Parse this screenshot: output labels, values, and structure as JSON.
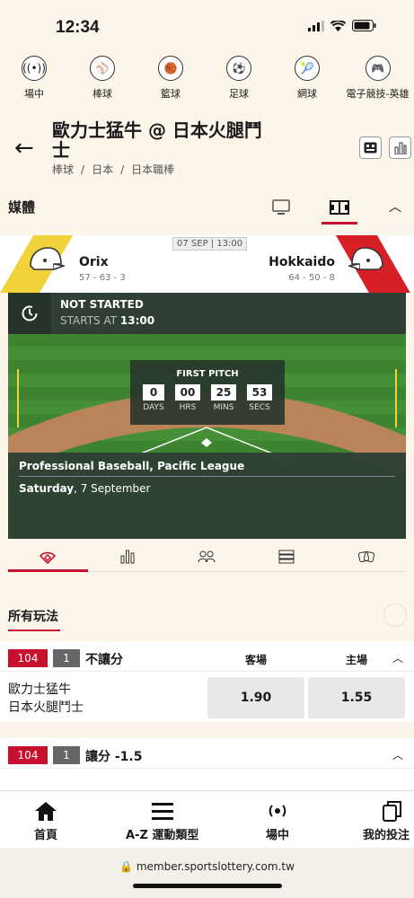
{
  "status_bar": {
    "time": "12:34"
  },
  "sports": [
    {
      "label": "場中",
      "icon": "live-icon"
    },
    {
      "label": "棒球",
      "icon": "baseball-icon"
    },
    {
      "label": "籃球",
      "icon": "basketball-icon"
    },
    {
      "label": "足球",
      "icon": "soccer-icon"
    },
    {
      "label": "網球",
      "icon": "tennis-icon"
    },
    {
      "label": "電子競技-英雄",
      "icon": "gamepad-icon"
    }
  ],
  "header": {
    "title": "歐力士猛牛 @ 日本火腿鬥士",
    "breadcrumb": [
      "棒球",
      "日本",
      "日本職棒"
    ]
  },
  "media": {
    "label": "媒體"
  },
  "match": {
    "date": "07 SEP | 13:00",
    "home": {
      "name": "Orix",
      "record": "57 - 63 - 3"
    },
    "away": {
      "name": "Hokkaido",
      "record": "64 - 50 - 8"
    },
    "status": "NOT STARTED",
    "starts_at_label": "STARTS AT",
    "starts_at_time": "13:00",
    "countdown_title": "FIRST PITCH",
    "countdown": [
      {
        "value": "0",
        "label": "DAYS"
      },
      {
        "value": "00",
        "label": "HRS"
      },
      {
        "value": "25",
        "label": "MINS"
      },
      {
        "value": "53",
        "label": "SECS"
      }
    ],
    "league": "Professional Baseball, Pacific League",
    "day": "Saturday",
    "day_date": ", 7 September"
  },
  "bets": {
    "section_title": "所有玩法",
    "markets": [
      {
        "code": "104",
        "num": "1",
        "type": "不讓分",
        "col1": "客場",
        "col2": "主場",
        "team1": "歐力士猛牛",
        "team2": "日本火腿鬥士",
        "odd1": "1.90",
        "odd2": "1.55"
      },
      {
        "code": "104",
        "num": "1",
        "type": "讓分 -1.5"
      }
    ]
  },
  "nav": {
    "home": "首頁",
    "az": "A-Z 運動類型",
    "live": "場中",
    "mybets": "我的投注"
  },
  "url": "member.sportslottery.com.tw",
  "colors": {
    "accent": "#c8102e",
    "background": "#fbf5ea",
    "field": "#3f8a32"
  }
}
